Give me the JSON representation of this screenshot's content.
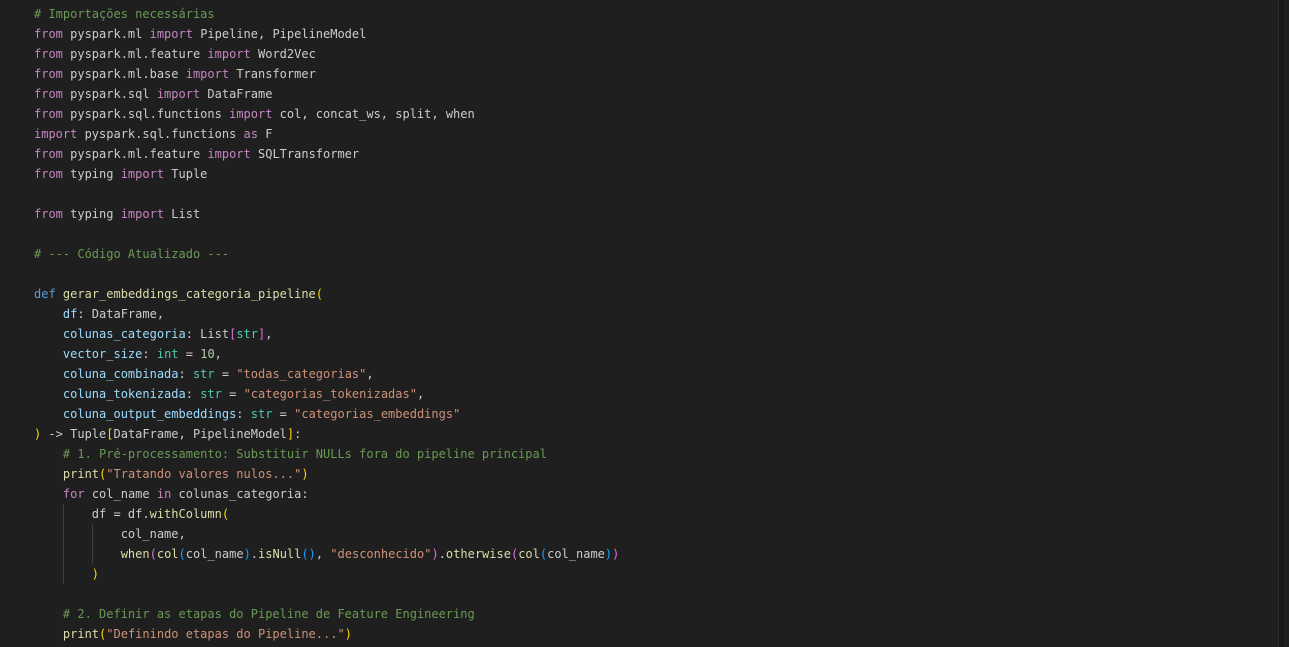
{
  "editor": {
    "lines": [
      [
        {
          "t": "# Importações necessárias",
          "c": "cmt"
        }
      ],
      [
        {
          "t": "from",
          "c": "kw"
        },
        {
          "t": " pyspark.ml "
        },
        {
          "t": "import",
          "c": "kw"
        },
        {
          "t": " Pipeline, PipelineModel"
        }
      ],
      [
        {
          "t": "from",
          "c": "kw"
        },
        {
          "t": " pyspark.ml.feature "
        },
        {
          "t": "import",
          "c": "kw"
        },
        {
          "t": " Word2Vec"
        }
      ],
      [
        {
          "t": "from",
          "c": "kw"
        },
        {
          "t": " pyspark.ml.base "
        },
        {
          "t": "import",
          "c": "kw"
        },
        {
          "t": " Transformer"
        }
      ],
      [
        {
          "t": "from",
          "c": "kw"
        },
        {
          "t": " pyspark.sql "
        },
        {
          "t": "import",
          "c": "kw"
        },
        {
          "t": " DataFrame"
        }
      ],
      [
        {
          "t": "from",
          "c": "kw"
        },
        {
          "t": " pyspark.sql.functions "
        },
        {
          "t": "import",
          "c": "kw"
        },
        {
          "t": " col, concat_ws, split, when"
        }
      ],
      [
        {
          "t": "import",
          "c": "kw"
        },
        {
          "t": " pyspark.sql.functions "
        },
        {
          "t": "as",
          "c": "kw"
        },
        {
          "t": " F"
        }
      ],
      [
        {
          "t": "from",
          "c": "kw"
        },
        {
          "t": " pyspark.ml.feature "
        },
        {
          "t": "import",
          "c": "kw"
        },
        {
          "t": " SQLTransformer"
        }
      ],
      [
        {
          "t": "from",
          "c": "kw"
        },
        {
          "t": " typing "
        },
        {
          "t": "import",
          "c": "kw"
        },
        {
          "t": " Tuple"
        }
      ],
      [],
      [
        {
          "t": "from",
          "c": "kw"
        },
        {
          "t": " typing "
        },
        {
          "t": "import",
          "c": "kw"
        },
        {
          "t": " List"
        }
      ],
      [],
      [
        {
          "t": "# --- Código Atualizado ---",
          "c": "cmt"
        }
      ],
      [],
      [
        {
          "t": "def",
          "c": "def"
        },
        {
          "t": " "
        },
        {
          "t": "gerar_embeddings_categoria_pipeline",
          "c": "fn"
        },
        {
          "t": "(",
          "c": "b1"
        }
      ],
      [
        {
          "t": "    "
        },
        {
          "t": "df",
          "c": "prm"
        },
        {
          "t": ": DataFrame,"
        }
      ],
      [
        {
          "t": "    "
        },
        {
          "t": "colunas_categoria",
          "c": "prm"
        },
        {
          "t": ": List"
        },
        {
          "t": "[",
          "c": "b2"
        },
        {
          "t": "str",
          "c": "typ"
        },
        {
          "t": "]",
          "c": "b2"
        },
        {
          "t": ","
        }
      ],
      [
        {
          "t": "    "
        },
        {
          "t": "vector_size",
          "c": "prm"
        },
        {
          "t": ": "
        },
        {
          "t": "int",
          "c": "typ"
        },
        {
          "t": " = "
        },
        {
          "t": "10",
          "c": "num"
        },
        {
          "t": ","
        }
      ],
      [
        {
          "t": "    "
        },
        {
          "t": "coluna_combinada",
          "c": "prm"
        },
        {
          "t": ": "
        },
        {
          "t": "str",
          "c": "typ"
        },
        {
          "t": " = "
        },
        {
          "t": "\"todas_categorias\"",
          "c": "str"
        },
        {
          "t": ","
        }
      ],
      [
        {
          "t": "    "
        },
        {
          "t": "coluna_tokenizada",
          "c": "prm"
        },
        {
          "t": ": "
        },
        {
          "t": "str",
          "c": "typ"
        },
        {
          "t": " = "
        },
        {
          "t": "\"categorias_tokenizadas\"",
          "c": "str"
        },
        {
          "t": ","
        }
      ],
      [
        {
          "t": "    "
        },
        {
          "t": "coluna_output_embeddings",
          "c": "prm"
        },
        {
          "t": ": "
        },
        {
          "t": "str",
          "c": "typ"
        },
        {
          "t": " = "
        },
        {
          "t": "\"categorias_embeddings\"",
          "c": "str"
        }
      ],
      [
        {
          "t": ")",
          "c": "b1"
        },
        {
          "t": " -> Tuple"
        },
        {
          "t": "[",
          "c": "b1"
        },
        {
          "t": "DataFrame, PipelineModel"
        },
        {
          "t": "]",
          "c": "b1"
        },
        {
          "t": ":"
        }
      ],
      [
        {
          "t": "    "
        },
        {
          "t": "# 1. Pré-processamento: Substituir NULLs fora do pipeline principal",
          "c": "cmt"
        }
      ],
      [
        {
          "t": "    "
        },
        {
          "t": "print",
          "c": "fn"
        },
        {
          "t": "(",
          "c": "b1"
        },
        {
          "t": "\"Tratando valores nulos...\"",
          "c": "str"
        },
        {
          "t": ")",
          "c": "b1"
        }
      ],
      [
        {
          "t": "    "
        },
        {
          "t": "for",
          "c": "kw"
        },
        {
          "t": " col_name "
        },
        {
          "t": "in",
          "c": "kw"
        },
        {
          "t": " colunas_categoria:"
        }
      ],
      [
        {
          "t": "        "
        },
        {
          "t": "df = df."
        },
        {
          "t": "withColumn",
          "c": "fn"
        },
        {
          "t": "(",
          "c": "b1"
        }
      ],
      [
        {
          "t": "            "
        },
        {
          "t": "col_name,"
        }
      ],
      [
        {
          "t": "            "
        },
        {
          "t": "when",
          "c": "fn"
        },
        {
          "t": "(",
          "c": "b2"
        },
        {
          "t": "col",
          "c": "fn"
        },
        {
          "t": "(",
          "c": "b3"
        },
        {
          "t": "col_name"
        },
        {
          "t": ")",
          "c": "b3"
        },
        {
          "t": "."
        },
        {
          "t": "isNull",
          "c": "fn"
        },
        {
          "t": "()",
          "c": "b3"
        },
        {
          "t": ", "
        },
        {
          "t": "\"desconhecido\"",
          "c": "str"
        },
        {
          "t": ")",
          "c": "b2"
        },
        {
          "t": "."
        },
        {
          "t": "otherwise",
          "c": "fn"
        },
        {
          "t": "(",
          "c": "b2"
        },
        {
          "t": "col",
          "c": "fn"
        },
        {
          "t": "(",
          "c": "b3"
        },
        {
          "t": "col_name"
        },
        {
          "t": ")",
          "c": "b3"
        },
        {
          "t": ")",
          "c": "b2"
        }
      ],
      [
        {
          "t": "        "
        },
        {
          "t": ")",
          "c": "b1"
        }
      ],
      [],
      [
        {
          "t": "    "
        },
        {
          "t": "# 2. Definir as etapas do Pipeline de Feature Engineering",
          "c": "cmt"
        }
      ],
      [
        {
          "t": "    "
        },
        {
          "t": "print",
          "c": "fn"
        },
        {
          "t": "(",
          "c": "b1"
        },
        {
          "t": "\"Definindo etapas do Pipeline...\"",
          "c": "str"
        },
        {
          "t": ")",
          "c": "b1"
        }
      ]
    ]
  }
}
